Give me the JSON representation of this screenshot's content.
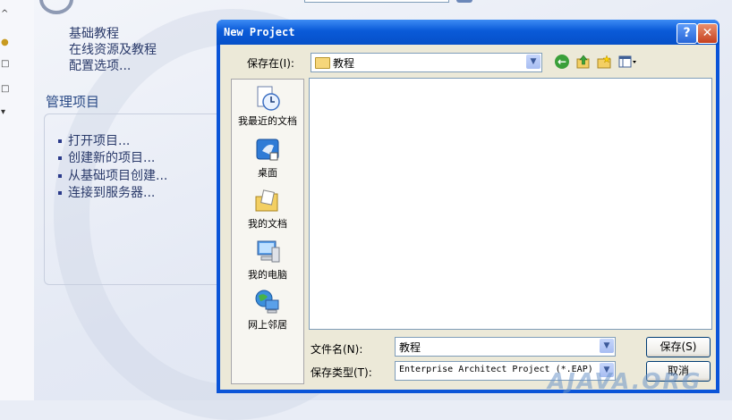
{
  "background_app": {
    "links": [
      "基础教程",
      "在线资源及教程",
      "配置选项..."
    ],
    "section_title": "管理项目",
    "bullets": [
      "打开项目...",
      "创建新的项目...",
      "从基础项目创建...",
      "连接到服务器..."
    ]
  },
  "dialog": {
    "title": "New Project",
    "help_glyph": "?",
    "close_glyph": "✕",
    "save_in_label": "保存在(I):",
    "save_in_value": "教程",
    "places": [
      "我最近的文档",
      "桌面",
      "我的文档",
      "我的电脑",
      "网上邻居"
    ],
    "file_name_label": "文件名(N):",
    "file_name_value": "教程",
    "file_type_label": "保存类型(T):",
    "file_type_value": "Enterprise Architect Project (*.EAP)",
    "save_button": "保存(S)",
    "cancel_button": "取消"
  },
  "watermark": "AJAVA.ORG",
  "colors": {
    "titlebar": "#0a54d8",
    "dialog_face": "#ece9d8",
    "link_text": "#2a3a6a"
  }
}
